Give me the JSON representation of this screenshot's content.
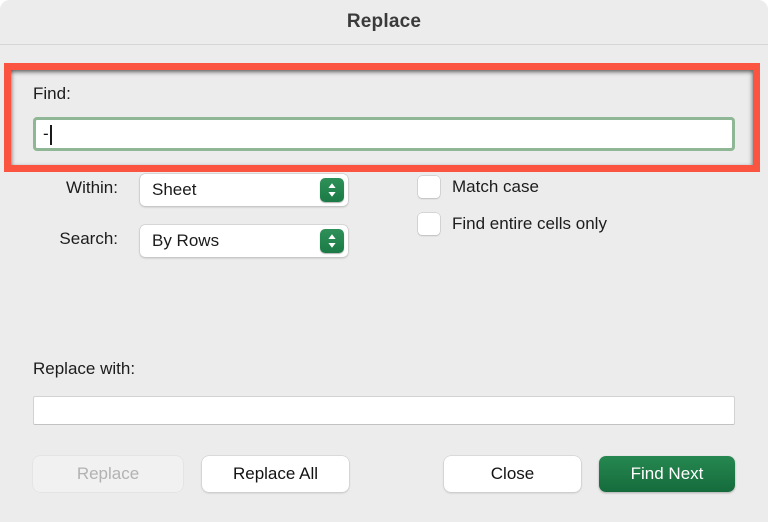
{
  "window": {
    "title": "Replace",
    "background_color": "#ececec"
  },
  "annotation": {
    "name": "find-field-highlight",
    "color": "#fb5441"
  },
  "find": {
    "label": "Find:",
    "value": "-",
    "placeholder": "",
    "focus_ring_color": "#8fb795",
    "has_caret": true
  },
  "options": {
    "within": {
      "label": "Within:",
      "value": "Sheet",
      "stepper_icon": "chevron-up-down-icon"
    },
    "search": {
      "label": "Search:",
      "value": "By Rows",
      "stepper_icon": "chevron-up-down-icon"
    },
    "match_case": {
      "label": "Match case",
      "checked": false
    },
    "find_entire_cells_only": {
      "label": "Find entire cells only",
      "checked": false
    }
  },
  "replace": {
    "label": "Replace with:",
    "value": "",
    "placeholder": ""
  },
  "buttons": {
    "replace": {
      "label": "Replace",
      "enabled": false
    },
    "replace_all": {
      "label": "Replace All",
      "enabled": true
    },
    "close": {
      "label": "Close",
      "enabled": true
    },
    "find_next": {
      "label": "Find Next",
      "enabled": true,
      "is_default": true,
      "color": "#1b7a45"
    }
  }
}
